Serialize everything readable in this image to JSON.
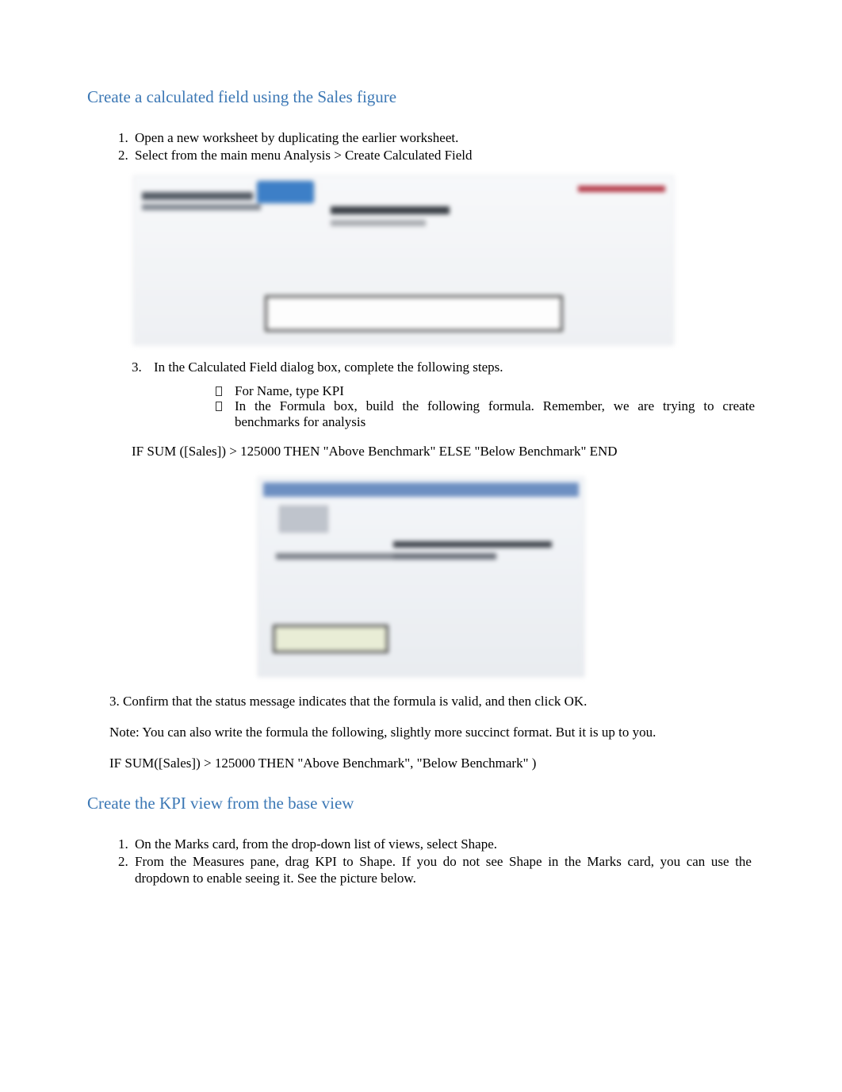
{
  "section1": {
    "heading": "Create a calculated field using the Sales figure",
    "step1": {
      "a": "Open a new worksheet by ",
      "b": "duplicating ",
      "c": "the earlier worksheet."
    },
    "step2": {
      "a": "Select from the main menu ",
      "b": "Analysis > Create Calculated Field"
    },
    "step3": {
      "num": "3.",
      "text": "In the Calculated Field dialog box, complete the following steps."
    },
    "bullets": {
      "b1": {
        "a": "For ",
        "b": "Name",
        "c": ", type ",
        "d": "KPI"
      },
      "b2": {
        "a": "In the ",
        "b": "Formula",
        "c": " box, build the following formula. Remember, we are trying to create benchmarks for analysis"
      }
    },
    "formula": "IF SUM ([Sales]) > 125000 THEN \"Above Benchmark\" ELSE \"Below Benchmark\" END",
    "confirm": {
      "a": "3. Confirm that the status message indicates that the formula is valid, and then click ",
      "b": "OK",
      "c": "."
    },
    "note": {
      "a": "Note:",
      "b": " You can also write the formula the following, slightly more succinct format. But it is up to you."
    },
    "formula2": "IF SUM([Sales]) > 125000 THEN \"Above Benchmark\", \"Below Benchmark\" )"
  },
  "section2": {
    "heading": "Create the KPI view from the base view",
    "step1": {
      "a": "On the Marks card, from the drop-down list of views, select ",
      "b": "Shape",
      "c": "."
    },
    "step2": {
      "a": "From the Measures pane, drag ",
      "b": "KPI ",
      "c": "to Shape. If you do not see Shape in the Marks card, you can use the dropdown to enable seeing it. See the picture below."
    }
  }
}
